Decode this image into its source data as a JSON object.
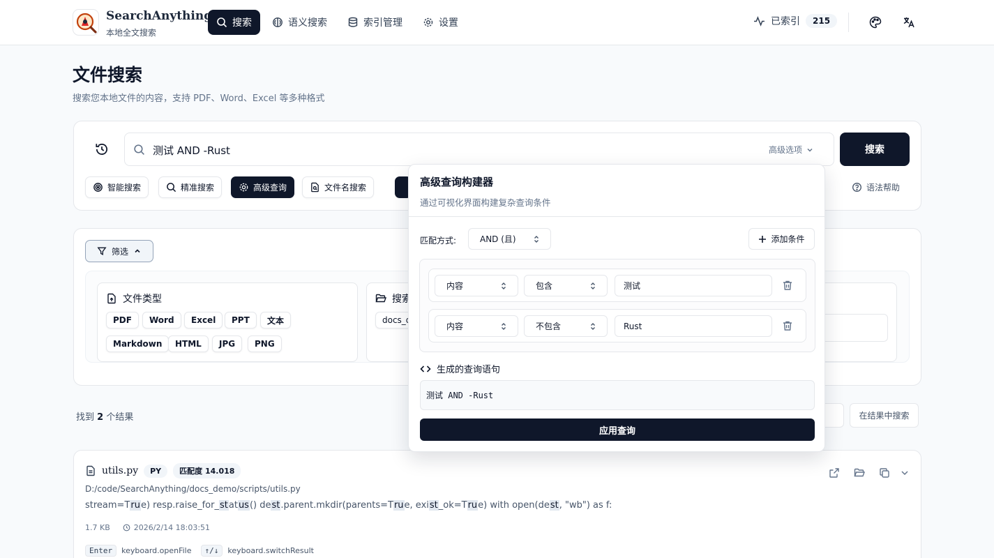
{
  "header": {
    "brand_name": "SearchAnything",
    "brand_sub": "本地全文搜索",
    "nav": [
      {
        "label": "搜索",
        "icon": "search-icon",
        "active": true
      },
      {
        "label": "语义搜索",
        "icon": "brain-icon"
      },
      {
        "label": "索引管理",
        "icon": "database-icon"
      },
      {
        "label": "设置",
        "icon": "gear-icon"
      }
    ],
    "indexed_label": "已索引",
    "indexed_count": "215"
  },
  "page": {
    "title": "文件搜索",
    "subtitle": "搜索您本地文件的内容，支持 PDF、Word、Excel 等多种格式"
  },
  "search": {
    "query": "测试 AND -Rust",
    "advanced_options": "高级选项",
    "search_button": "搜索",
    "modes": [
      "智能搜索",
      "精准搜索",
      "高级查询",
      "文件名搜索"
    ],
    "active_mode": "高级查询",
    "syntax_help": "语法帮助"
  },
  "filter": {
    "toggle": "筛选",
    "file_type_title": "文件类型",
    "types_row1": [
      "PDF",
      "Word",
      "Excel",
      "PPT",
      "文本"
    ],
    "types_row2": [
      "Markdown",
      "HTML",
      "JPG",
      "PNG"
    ],
    "scope_title": "搜索",
    "scope_value": "docs_d"
  },
  "results": {
    "count_prefix": "找到",
    "count": "2",
    "count_suffix": "个结果",
    "search_in_results": "在结果中搜索",
    "items": [
      {
        "name": "utils.py",
        "type": "PY",
        "score": "匹配度 14.018",
        "path": "D:/code/SearchAnything/docs_demo/scripts/utils.py",
        "snippet_parts": [
          {
            "t": "stream=T"
          },
          {
            "t": "ru",
            "h": true
          },
          {
            "t": "e) resp.raise_for_"
          },
          {
            "t": "st",
            "h": true
          },
          {
            "t": "at"
          },
          {
            "t": "us",
            "h": true
          },
          {
            "t": "() de"
          },
          {
            "t": "st",
            "h": true
          },
          {
            "t": ".parent.mkdir(parents=T"
          },
          {
            "t": "ru",
            "h": true
          },
          {
            "t": "e, exi"
          },
          {
            "t": "st",
            "h": true
          },
          {
            "t": "_ok=T"
          },
          {
            "t": "ru",
            "h": true
          },
          {
            "t": "e) with open(de"
          },
          {
            "t": "st",
            "h": true
          },
          {
            "t": ", \"wb\") as f:"
          }
        ],
        "size": "1.7 KB",
        "modified": "2026/2/14 18:03:51"
      }
    ],
    "kbd_enter": "Enter",
    "kbd_enter_label": "keyboard.openFile",
    "kbd_arrows": "↑/↓",
    "kbd_arrows_label": "keyboard.switchResult"
  },
  "builder": {
    "title": "高级查询构建器",
    "subtitle": "通过可视化界面构建复杂查询条件",
    "match_label": "匹配方式:",
    "match_value": "AND (且)",
    "add_condition": "添加条件",
    "conditions": [
      {
        "field": "内容",
        "op": "包含",
        "value": "测试"
      },
      {
        "field": "内容",
        "op": "不包含",
        "value": "Rust"
      }
    ],
    "generated_title": "生成的查询语句",
    "generated_query": "测试 AND -Rust",
    "apply_button": "应用查询"
  },
  "colors": {
    "primary": "#0f172a",
    "border": "#e5e7eb",
    "muted": "#64748b",
    "background": "#f8fafc"
  }
}
